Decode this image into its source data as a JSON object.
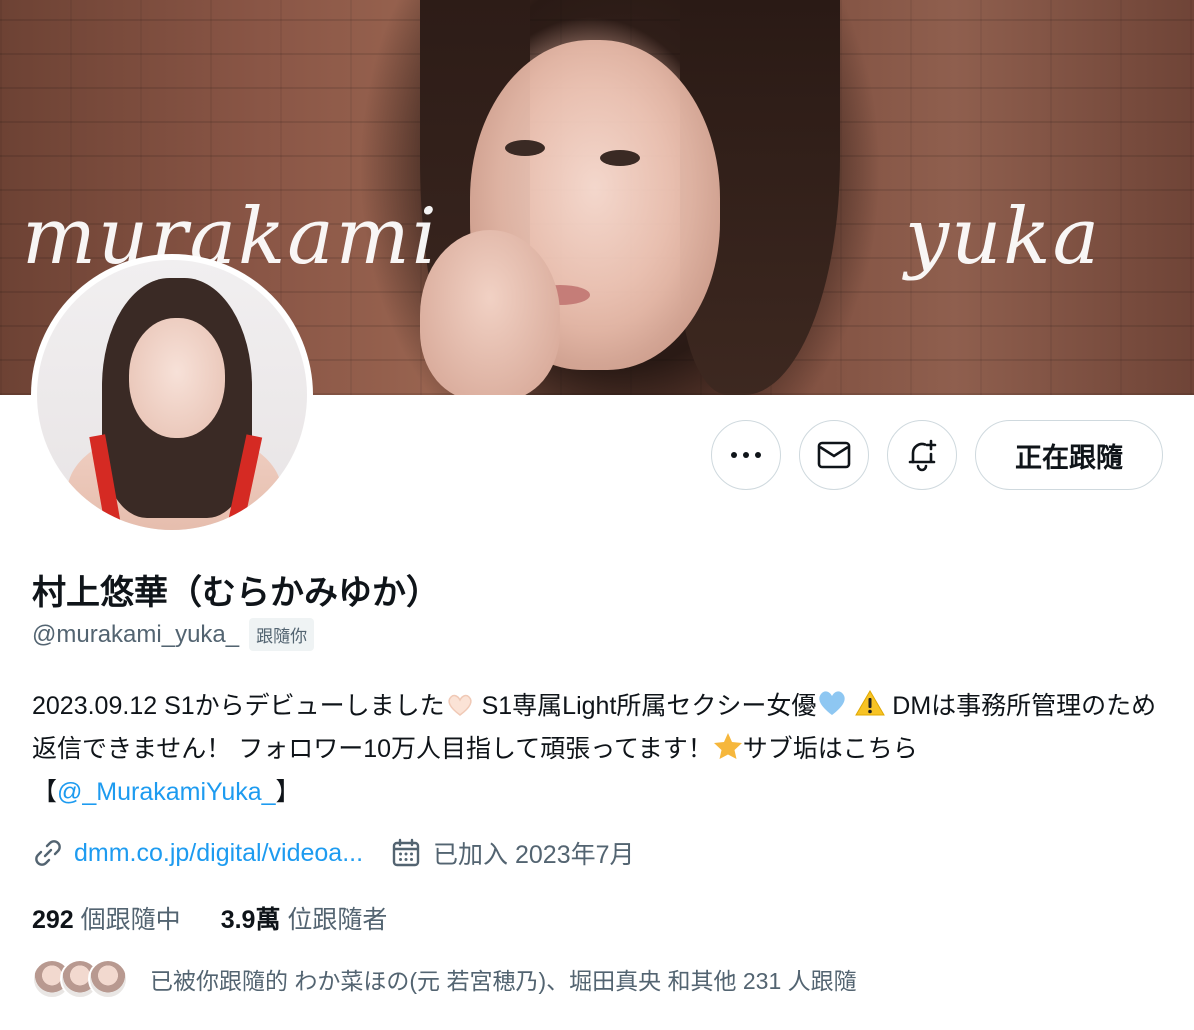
{
  "banner": {
    "text_left": "murakami",
    "text_right": "yuka"
  },
  "actions": {
    "more_icon": "more-dots-icon",
    "message_icon": "envelope-icon",
    "notify_icon": "bell-plus-icon",
    "follow_label": "正在跟隨"
  },
  "profile": {
    "display_name": "村上悠華（むらかみゆか）",
    "handle": "@murakami_yuka_",
    "follows_you": "跟隨你",
    "bio": {
      "part1": "2023.09.12 S1からデビューしました",
      "part2": " S1専属Light所属セクシー女優",
      "part3": " DMは事務所管理のため返信できません！ フォロワー10万人目指して頑張ってます！",
      "part4": "サブ垢はこちら【",
      "mention": "@_MurakamiYuka_",
      "part5": "】"
    },
    "link": "dmm.co.jp/digital/videoa...",
    "joined": "已加入 2023年7月"
  },
  "stats": {
    "following_count": "292",
    "following_label": "個跟隨中",
    "followers_count": "3.9萬",
    "followers_label": "位跟隨者"
  },
  "followed_by": {
    "text": "已被你跟隨的 わか菜ほの(元 若宮穂乃)、堀田真央 和其他 231 人跟隨"
  },
  "colors": {
    "accent": "#1d9bf0",
    "text_primary": "#0f1419",
    "text_secondary": "#536471",
    "border": "#cfd9de"
  }
}
